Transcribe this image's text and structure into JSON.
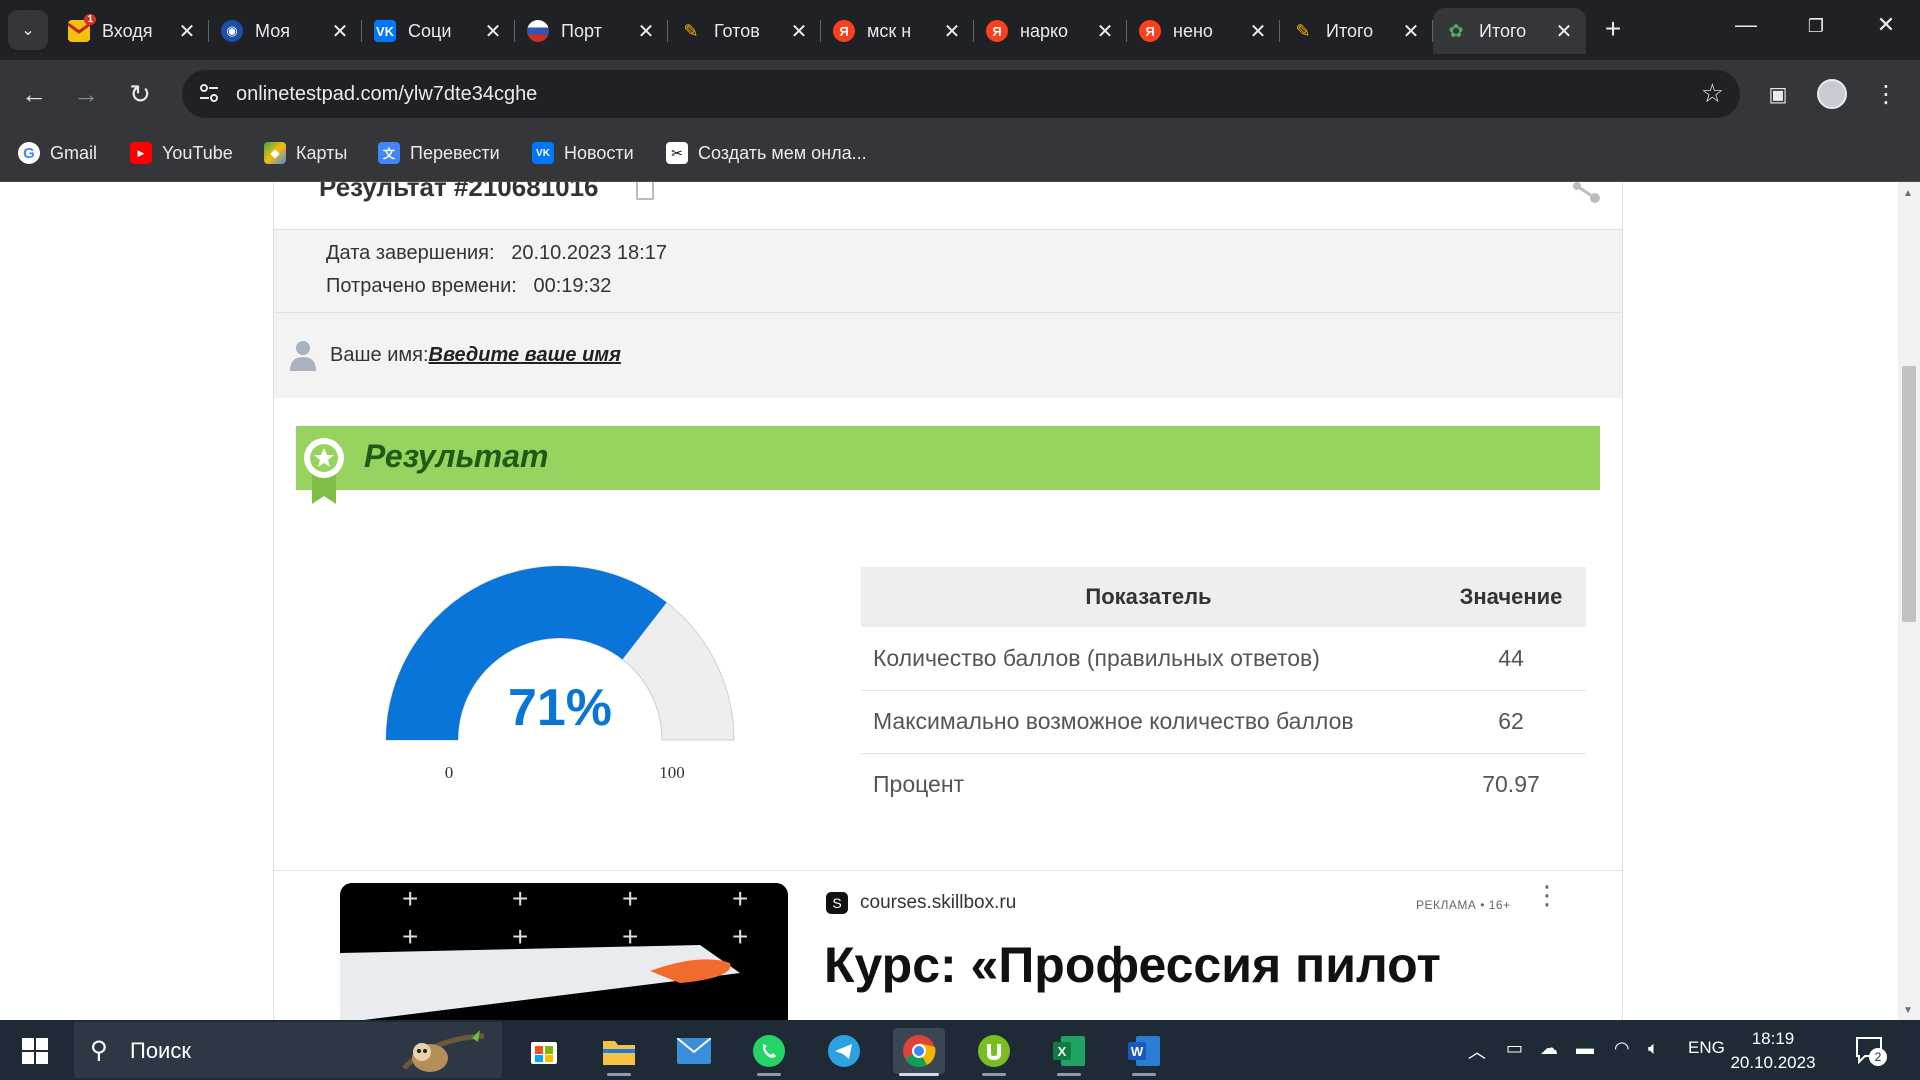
{
  "browser": {
    "tabs": [
      {
        "title": "Входя",
        "icon": "gmail-favicon",
        "badge": "1",
        "color": "#f4c20d"
      },
      {
        "title": "Моя",
        "icon": "gosuslugi-favicon",
        "color": "#1e4fa8"
      },
      {
        "title": "Соци",
        "icon": "vk-favicon",
        "color": "#0077ff"
      },
      {
        "title": "Порт",
        "icon": "russia-flag-favicon",
        "color": "#d52b1e"
      },
      {
        "title": "Готов",
        "icon": "ai-favicon",
        "color": "#f7b500"
      },
      {
        "title": "мск н",
        "icon": "yandex-favicon",
        "color": "#fc3f1d"
      },
      {
        "title": "нарко",
        "icon": "yandex-favicon",
        "color": "#fc3f1d"
      },
      {
        "title": "нено",
        "icon": "yandex-favicon",
        "color": "#fc3f1d"
      },
      {
        "title": "Итого",
        "icon": "ai-favicon",
        "color": "#f7b500"
      },
      {
        "title": "Итого",
        "icon": "onlinetestpad-favicon",
        "color": "#4caf50",
        "active": true
      }
    ],
    "url": "onlinetestpad.com/ylw7dte34cghe",
    "bookmarks": [
      {
        "label": "Gmail",
        "icon": "google-icon"
      },
      {
        "label": "YouTube",
        "icon": "youtube-icon"
      },
      {
        "label": "Карты",
        "icon": "maps-icon"
      },
      {
        "label": "Перевести",
        "icon": "translate-icon"
      },
      {
        "label": "Новости",
        "icon": "vk-icon"
      },
      {
        "label": "Создать мем онла...",
        "icon": "meme-icon"
      }
    ]
  },
  "page": {
    "result_title": "Результат #210681016",
    "completion_label": "Дата завершения:",
    "completion_value": "20.10.2023 18:17",
    "time_label": "Потрачено времени:",
    "time_value": "00:19:32",
    "name_label": "Ваше имя:",
    "name_link": "Введите ваше имя",
    "result_heading": "Результат",
    "gauge": {
      "percent_text": "71%",
      "value": 71,
      "min_label": "0",
      "max_label": "100",
      "fill_color": "#0a75d8",
      "track_color": "#eeeeee"
    },
    "table": {
      "headers": [
        "Показатель",
        "Значение"
      ],
      "rows": [
        {
          "indicator": "Количество баллов (правильных ответов)",
          "value": "44"
        },
        {
          "indicator": "Максимально возможное количество баллов",
          "value": "62"
        },
        {
          "indicator": "Процент",
          "value": "70.97"
        }
      ]
    },
    "ad": {
      "source": "courses.skillbox.ru",
      "source_letter": "S",
      "tag": "РЕКЛАМА • 16+",
      "title": "Курс: «Профессия пилот"
    }
  },
  "taskbar": {
    "search_text": "Поиск",
    "lang": "ENG",
    "time": "18:19",
    "date": "20.10.2023",
    "notifications": "2"
  }
}
